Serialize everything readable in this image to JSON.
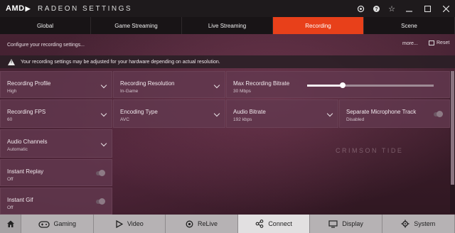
{
  "titlebar": {
    "logo": "AMD",
    "logo_mark": "▶",
    "title": "RADEON SETTINGS",
    "icons": [
      "camera-icon",
      "help-icon",
      "star-icon"
    ],
    "window_buttons": [
      "minimize",
      "maximize",
      "close"
    ]
  },
  "tabs": [
    {
      "label": "Global",
      "active": false
    },
    {
      "label": "Game Streaming",
      "active": false
    },
    {
      "label": "Live Streaming",
      "active": false
    },
    {
      "label": "Recording",
      "active": true
    },
    {
      "label": "Scene",
      "active": false
    }
  ],
  "subheader": {
    "configure_text": "Configure your recording settings...",
    "more_label": "more...",
    "reset_label": "Reset"
  },
  "warning": {
    "message": "Your recording settings may be adjusted for your hardware depending on actual resolution."
  },
  "settings": {
    "recording_profile": {
      "label": "Recording Profile",
      "value": "High"
    },
    "recording_resolution": {
      "label": "Recording Resolution",
      "value": "In-Game"
    },
    "max_recording_bitrate": {
      "label": "Max Recording Bitrate",
      "value": "30 Mbps",
      "slider_fraction": 0.28
    },
    "recording_fps": {
      "label": "Recording FPS",
      "value": "60"
    },
    "encoding_type": {
      "label": "Encoding Type",
      "value": "AVC"
    },
    "audio_bitrate": {
      "label": "Audio Bitrate",
      "value": "192 kbps"
    },
    "separate_microphone_track": {
      "label": "Separate Microphone Track",
      "value": "Disabled"
    },
    "audio_channels": {
      "label": "Audio Channels",
      "value": "Automatic"
    },
    "instant_replay": {
      "label": "Instant Replay",
      "value": "Off"
    },
    "instant_gif": {
      "label": "Instant Gif",
      "value": "Off"
    }
  },
  "watermark": {
    "text": "CRIMSON TIDE"
  },
  "bottom_nav": [
    {
      "label": "Gaming",
      "icon": "gamepad-icon",
      "active": false
    },
    {
      "label": "Video",
      "icon": "play-icon",
      "active": false
    },
    {
      "label": "ReLive",
      "icon": "relive-icon",
      "active": false
    },
    {
      "label": "Connect",
      "icon": "share-icon",
      "active": true
    },
    {
      "label": "Display",
      "icon": "monitor-icon",
      "active": false
    },
    {
      "label": "System",
      "icon": "gear-icon",
      "active": false
    }
  ]
}
